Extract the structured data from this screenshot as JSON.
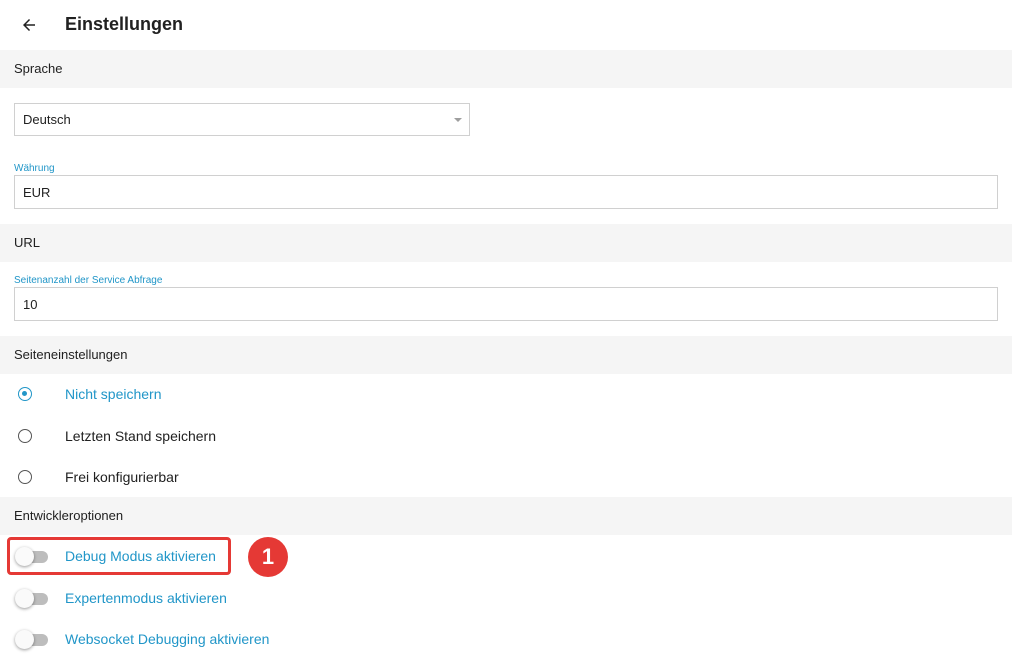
{
  "header": {
    "title": "Einstellungen",
    "back_icon": "arrow-left-icon"
  },
  "sections": {
    "language": "Sprache",
    "url": "URL",
    "page_settings": "Seiteneinstellungen",
    "developer": "Entwickleroptionen"
  },
  "language_select": {
    "value": "Deutsch"
  },
  "currency": {
    "label": "Währung",
    "value": "EUR"
  },
  "page_count": {
    "label": "Seitenanzahl der Service Abfrage",
    "value": "10"
  },
  "page_options": [
    {
      "label": "Nicht speichern",
      "selected": true
    },
    {
      "label": "Letzten Stand speichern",
      "selected": false
    },
    {
      "label": "Frei konfigurierbar",
      "selected": false
    }
  ],
  "developer_options": [
    {
      "label": "Debug Modus aktivieren",
      "enabled": false
    },
    {
      "label": "Expertenmodus aktivieren",
      "enabled": false
    },
    {
      "label": "Websocket Debugging aktivieren",
      "enabled": false
    }
  ],
  "callout": {
    "number": "1"
  },
  "colors": {
    "accent": "#2196c8",
    "highlight": "#e53935",
    "section_bg": "#f5f5f5"
  }
}
